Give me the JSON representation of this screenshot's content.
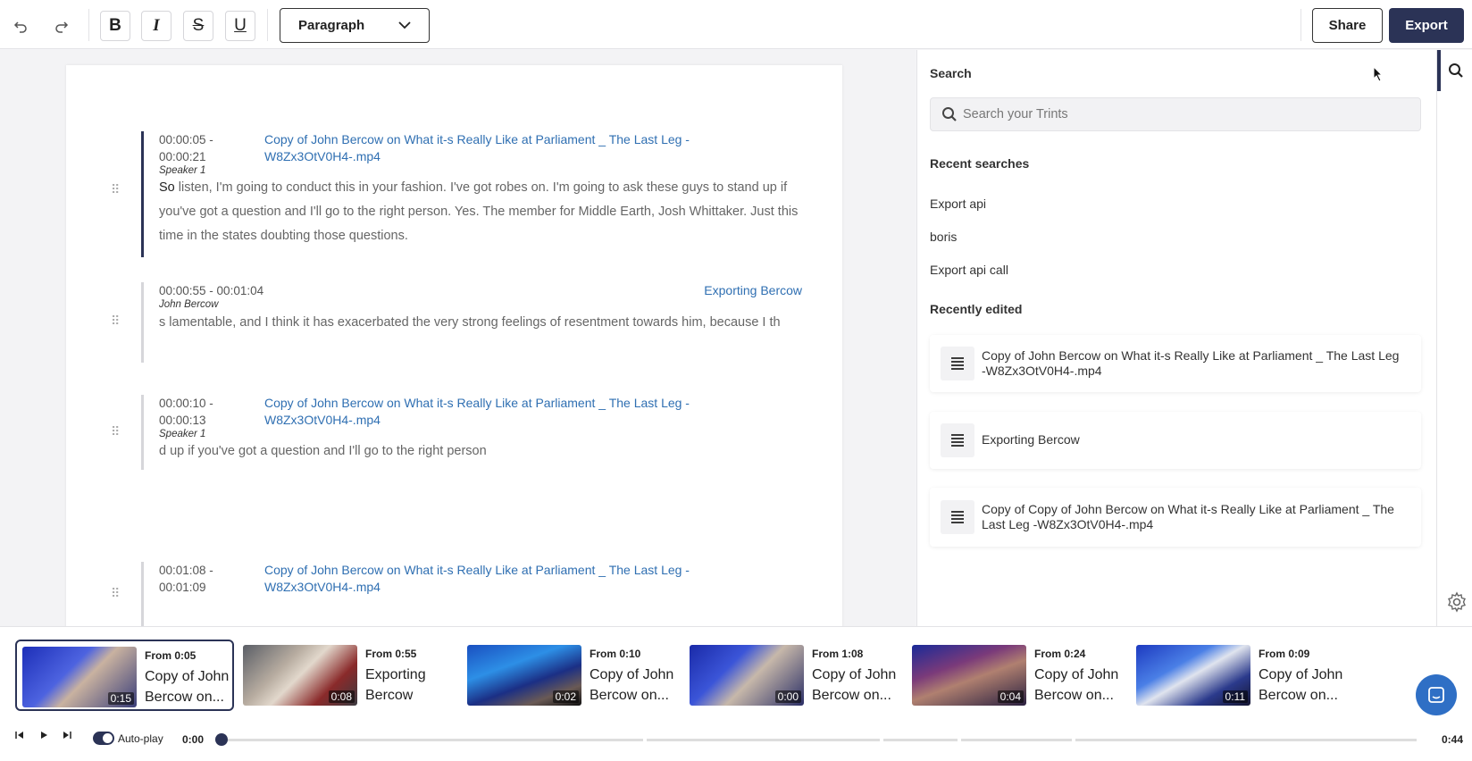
{
  "toolbar": {
    "undo_icon": "undo-icon",
    "redo_icon": "redo-icon",
    "bold_label": "B",
    "italic_label": "I",
    "strike_label": "S",
    "underline_label": "U",
    "paragraph_value": "Paragraph",
    "share_label": "Share",
    "export_label": "Export"
  },
  "editor": {
    "blocks": [
      {
        "timestamp": "00:00:05 - 00:00:21",
        "speaker": "Speaker 1",
        "source": "Copy of John Bercow on What it-s Really Like at Parliament _ The Last Leg -W8Zx3OtV0H4-.mp4",
        "text_highlight": "So",
        "text": " listen, I'm going to conduct this in your fashion. I've got robes on. I'm going to ask these guys to stand up if you've got a question and I'll go to the right person. Yes. The member for Middle Earth, Josh Whittaker. Just this time in the states doubting those questions."
      },
      {
        "timestamp": "00:00:55 - 00:01:04",
        "speaker": "John Bercow",
        "source": "Exporting Bercow",
        "text": "s lamentable, and I think it has exacerbated the very strong feelings of resentment towards him, because I th"
      },
      {
        "timestamp": "00:00:10 - 00:00:13",
        "speaker": "Speaker 1",
        "source": "Copy of John Bercow on What it-s Really Like at Parliament _ The Last Leg -W8Zx3OtV0H4-.mp4",
        "text": "d up if you've got a question and I'll go to the right person"
      },
      {
        "timestamp": "00:01:08 - 00:01:09",
        "speaker": "",
        "source": "Copy of John Bercow on What it-s Really Like at Parliament _ The Last Leg -W8Zx3OtV0H4-.mp4",
        "text": ""
      }
    ]
  },
  "search": {
    "title": "Search",
    "placeholder": "Search your Trints",
    "recent_heading": "Recent searches",
    "recent": [
      "Export api",
      "boris",
      "Export api call"
    ],
    "edited_heading": "Recently edited",
    "edited": [
      "Copy of John Bercow on What it-s Really Like at Parliament _ The Last Leg -W8Zx3OtV0H4-.mp4",
      "Exporting Bercow",
      "Copy of Copy of John Bercow on What it-s Really Like at Parliament _ The Last Leg -W8Zx3OtV0H4-.mp4"
    ]
  },
  "player": {
    "clips": [
      {
        "from": "From 0:05",
        "title": "Copy of John Bercow on...",
        "duration": "0:15"
      },
      {
        "from": "From 0:55",
        "title": "Exporting Bercow",
        "duration": "0:08"
      },
      {
        "from": "From 0:10",
        "title": "Copy of John Bercow on...",
        "duration": "0:02"
      },
      {
        "from": "From 1:08",
        "title": "Copy of John Bercow on...",
        "duration": "0:00"
      },
      {
        "from": "From 0:24",
        "title": "Copy of John Bercow on...",
        "duration": "0:04"
      },
      {
        "from": "From 0:09",
        "title": "Copy of John Bercow on...",
        "duration": "0:11"
      }
    ],
    "autoplay_label": "Auto-play",
    "autoplay_on": true,
    "current_time": "0:00",
    "total_time": "0:44",
    "progress": 0.0
  },
  "colors": {
    "accent": "#2b3356",
    "link": "#2f6fb2",
    "chat": "#2f6fc5"
  }
}
